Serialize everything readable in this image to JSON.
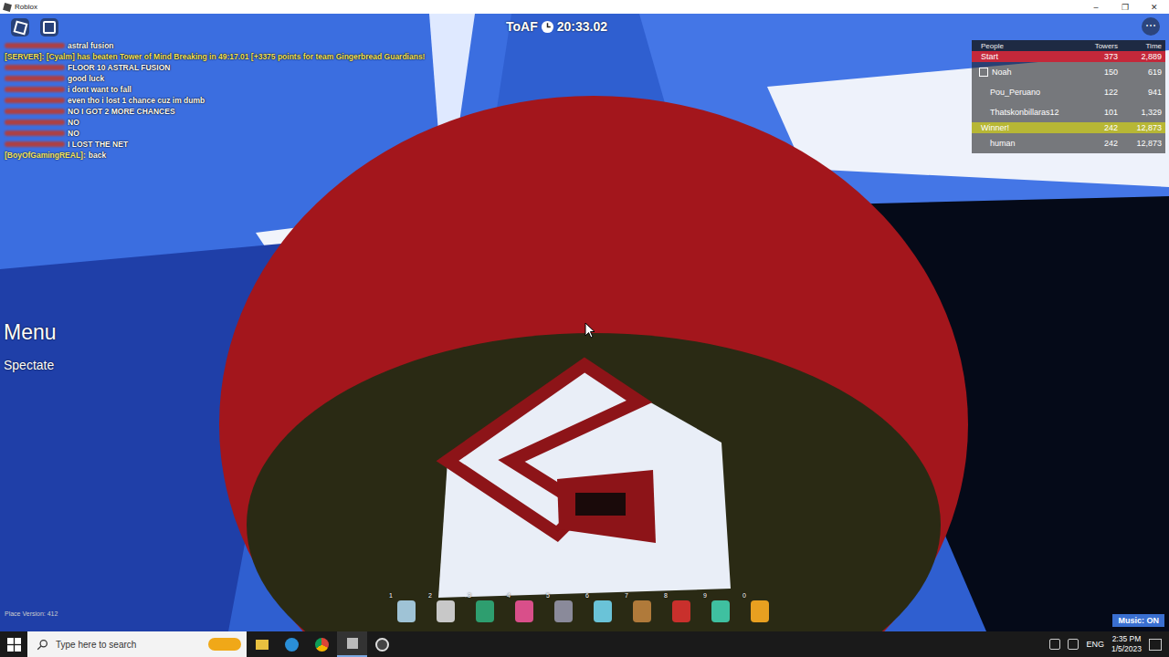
{
  "window": {
    "title": "Roblox",
    "controls": [
      "–",
      "❐",
      "✕"
    ]
  },
  "hud": {
    "timer_label": "ToAF",
    "timer": "20:33.02",
    "menu": "Menu",
    "spectate": "Spectate",
    "place_version": "Place Version: 412",
    "music": "Music: ON"
  },
  "chat": [
    {
      "kind": "hidden",
      "name": "",
      "text": "astral fusion",
      "color": "#c0392b"
    },
    {
      "kind": "server",
      "name": "",
      "text": "[SERVER]: [Cyalm] has beaten Tower of Mind Breaking in 49:17.01 [+3375 points for team Gingerbread Guardians!",
      "color": "#f5e663"
    },
    {
      "kind": "hidden",
      "name": "",
      "text": "FLOOR 10 ASTRAL FUSION",
      "color": "#c0392b"
    },
    {
      "kind": "hidden",
      "name": "",
      "text": "good luck",
      "color": "#c0392b"
    },
    {
      "kind": "hidden",
      "name": "",
      "text": "i dont want to fall",
      "color": "#c0392b"
    },
    {
      "kind": "hidden",
      "name": "",
      "text": "even tho i lost 1 chance cuz im dumb",
      "color": "#c0392b"
    },
    {
      "kind": "hidden",
      "name": "",
      "text": "NO I GOT 2 MORE CHANCES",
      "color": "#c0392b"
    },
    {
      "kind": "hidden",
      "name": "",
      "text": "NO",
      "color": "#c0392b"
    },
    {
      "kind": "hidden",
      "name": "",
      "text": "NO",
      "color": "#c0392b"
    },
    {
      "kind": "hidden",
      "name": "",
      "text": "I LOST THE NET",
      "color": "#c0392b"
    },
    {
      "kind": "named",
      "name": "[BoyOfGamingREAL]:",
      "text": "back",
      "color": "#f5e663"
    }
  ],
  "leaderboard": {
    "columns": [
      "People",
      "Towers",
      "Time"
    ],
    "rows": [
      {
        "kind": "team",
        "name": "Start",
        "towers": "373",
        "time": "2,889",
        "color": "#c4283a"
      },
      {
        "kind": "player",
        "name": "Noah",
        "towers": "150",
        "time": "619",
        "color": "#000000"
      },
      {
        "kind": "player",
        "name": "Pou_Peruano",
        "towers": "122",
        "time": "941",
        "color": "#000000"
      },
      {
        "kind": "player",
        "name": "Thatskonbillaras12",
        "towers": "101",
        "time": "1,329",
        "color": "#000000"
      },
      {
        "kind": "team",
        "name": "Winner!",
        "towers": "242",
        "time": "12,873",
        "color": "#b7b735"
      },
      {
        "kind": "player",
        "name": "human",
        "towers": "242",
        "time": "12,873",
        "color": "#000000"
      }
    ]
  },
  "hotbar": [
    {
      "key": "1",
      "color": "#9fc3d6"
    },
    {
      "key": "2",
      "color": "#c8c8c8"
    },
    {
      "key": "3",
      "color": "#2e9e6f"
    },
    {
      "key": "4",
      "color": "#d94f8a"
    },
    {
      "key": "5",
      "color": "#8a8a9a"
    },
    {
      "key": "6",
      "color": "#6ac3d8"
    },
    {
      "key": "7",
      "color": "#b07a3a"
    },
    {
      "key": "8",
      "color": "#c9302c"
    },
    {
      "key": "9",
      "color": "#3fc0a0"
    },
    {
      "key": "0",
      "color": "#e8a020"
    }
  ],
  "taskbar": {
    "search": "Type here to search",
    "lang": "ENG",
    "time": "2:35 PM",
    "date": "1/5/2023"
  }
}
